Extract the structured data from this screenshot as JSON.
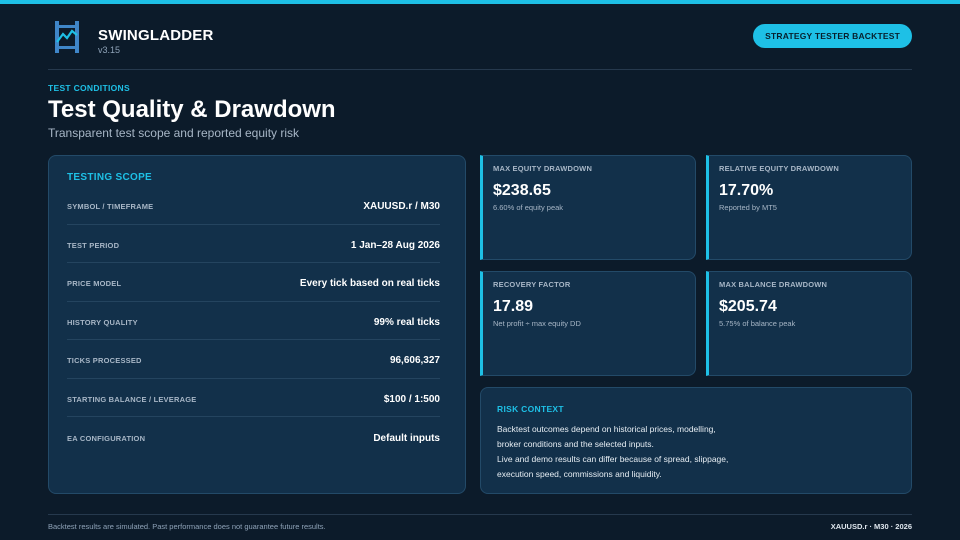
{
  "colors": {
    "accent": "#1ec0e6",
    "background": "#0c1b2a",
    "card": "#12304a"
  },
  "header": {
    "brand": "SWINGLADDER",
    "version": "v3.15",
    "logo_icon": "ladder-chart-icon",
    "badge": "STRATEGY TESTER BACKTEST"
  },
  "page": {
    "eyebrow": "TEST CONDITIONS",
    "title": "Test Quality & Drawdown",
    "subtitle": "Transparent test scope and reported equity risk"
  },
  "scope": {
    "title": "TESTING SCOPE",
    "rows": [
      {
        "label": "SYMBOL / TIMEFRAME",
        "value": "XAUUSD.r / M30"
      },
      {
        "label": "TEST PERIOD",
        "value": "1 Jan–28 Aug 2026"
      },
      {
        "label": "PRICE MODEL",
        "value": "Every tick based on real ticks"
      },
      {
        "label": "HISTORY QUALITY",
        "value": "99% real ticks"
      },
      {
        "label": "TICKS PROCESSED",
        "value": "96,606,327"
      },
      {
        "label": "STARTING BALANCE / LEVERAGE",
        "value": "$100 / 1:500"
      },
      {
        "label": "EA CONFIGURATION",
        "value": "Default inputs"
      }
    ]
  },
  "metrics": [
    {
      "label": "MAX EQUITY DRAWDOWN",
      "value": "$238.65",
      "note": "6.60% of equity peak"
    },
    {
      "label": "RELATIVE EQUITY DRAWDOWN",
      "value": "17.70%",
      "note": "Reported by MT5"
    },
    {
      "label": "RECOVERY FACTOR",
      "value": "17.89",
      "note": "Net profit ÷ max equity DD"
    },
    {
      "label": "MAX BALANCE DRAWDOWN",
      "value": "$205.74",
      "note": "5.75% of balance peak"
    }
  ],
  "risk": {
    "title": "RISK CONTEXT",
    "lines": [
      "Backtest outcomes depend on historical prices, modelling,",
      "broker conditions and the selected inputs.",
      "Live and demo results can differ because of spread, slippage,",
      "execution speed, commissions and liquidity."
    ]
  },
  "footer": {
    "disclaimer": "Backtest results are simulated. Past performance does not guarantee future results.",
    "meta": "XAUUSD.r · M30 · 2026"
  }
}
